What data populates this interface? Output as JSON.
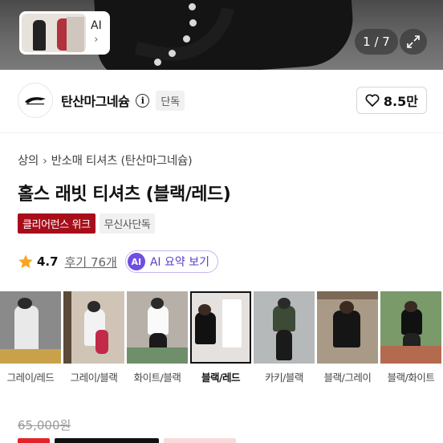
{
  "gallery": {
    "ai_label": "AI",
    "counter": "1 / 7"
  },
  "brand": {
    "name": "탄산마그네슘",
    "exclusive_label": "단독",
    "likes": "8.5만"
  },
  "breadcrumb": {
    "category": "상의",
    "subcategory": "반소매 티셔츠 (탄산마그네슘)"
  },
  "product": {
    "title": "홀스 래빗 티셔츠 (블랙/레드)",
    "badges": [
      "클리어런스 위크",
      "무신사단독"
    ],
    "rating": "4.7",
    "reviews": "후기 76개",
    "ai_summary": "AI 요약 보기"
  },
  "color_options": [
    {
      "label": "그레이/레드",
      "selected": false
    },
    {
      "label": "그레이/블랙",
      "selected": false
    },
    {
      "label": "화이트/블랙",
      "selected": false
    },
    {
      "label": "블랙/레드",
      "selected": true
    },
    {
      "label": "카키/블랙",
      "selected": false
    },
    {
      "label": "블랙/그레이",
      "selected": false
    },
    {
      "label": "블랙/화이트",
      "selected": false
    }
  ],
  "price": {
    "original": "65,000원"
  },
  "colors": {
    "accent_red": "#a80e1a",
    "ai_purple": "#6f4fe0",
    "sale_red": "#e3232c"
  }
}
